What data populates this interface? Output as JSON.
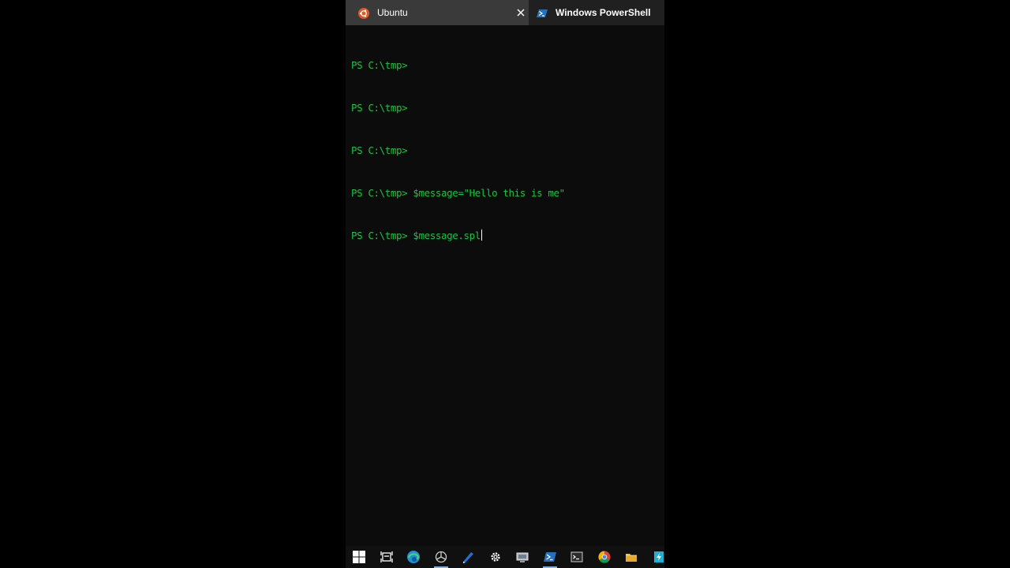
{
  "tabs": [
    {
      "label": "Ubuntu",
      "icon": "ubuntu-icon",
      "active": false
    },
    {
      "label": "Windows PowerShell",
      "icon": "powershell-icon",
      "active": true
    }
  ],
  "terminal": {
    "lines": [
      {
        "prompt": "PS C:\\tmp>",
        "command": ""
      },
      {
        "prompt": "PS C:\\tmp>",
        "command": ""
      },
      {
        "prompt": "PS C:\\tmp>",
        "command": ""
      },
      {
        "prompt": "PS C:\\tmp>",
        "command": " $message=\"Hello this is me\""
      },
      {
        "prompt": "PS C:\\tmp>",
        "command": " $message.spl"
      }
    ]
  },
  "taskbar": {
    "icons": [
      "windows-start-icon",
      "task-view-icon",
      "edge-icon",
      "app-icon",
      "pen-icon",
      "settings-icon",
      "monitor-app-icon",
      "powershell-taskbar-icon",
      "terminal-taskbar-icon",
      "chrome-icon",
      "file-explorer-icon",
      "power-automate-icon"
    ]
  },
  "colors": {
    "terminal_text": "#15c341",
    "background": "#0c0c0c",
    "tab_active": "#202020",
    "tab_inactive": "#3a3a3a",
    "ubuntu": "#e95420",
    "accent": "#0078d4"
  }
}
